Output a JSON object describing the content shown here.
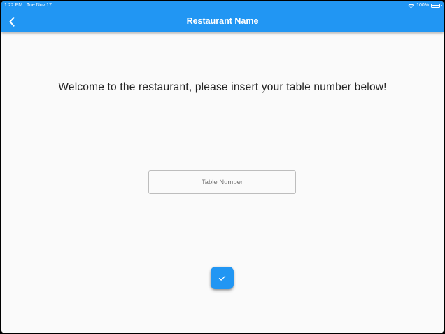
{
  "status_bar": {
    "time": "1:22 PM",
    "date": "Tue Nov 17",
    "wifi_icon": "wifi-icon",
    "battery_percent": "100%",
    "battery_icon": "battery-icon"
  },
  "app_bar": {
    "back_icon": "chevron-left-icon",
    "title": "Restaurant Name",
    "color": "#2196f3"
  },
  "main": {
    "welcome_text": "Welcome to the restaurant, please insert your table number below!",
    "table_input": {
      "placeholder": "Table Number",
      "value": ""
    },
    "submit_button": {
      "icon": "check-icon"
    }
  }
}
